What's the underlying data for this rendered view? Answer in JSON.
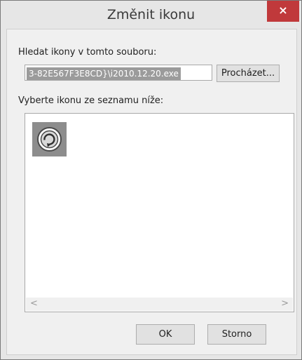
{
  "dialog": {
    "title": "Změnit ikonu",
    "close_glyph": "×"
  },
  "search_section": {
    "label": "Hledat ikony v tomto souboru:",
    "path_value": "3-82E567F3E8CD}\\i2010.12.20.exe",
    "browse_label": "Procházet..."
  },
  "icon_section": {
    "label": "Vyberte ikonu ze seznamu níže:",
    "icons": [
      {
        "name": "refresh-circle-icon",
        "selected": true
      }
    ],
    "scroll_left_glyph": "<",
    "scroll_right_glyph": ">"
  },
  "footer": {
    "ok_label": "OK",
    "cancel_label": "Storno"
  },
  "colors": {
    "close_button": "#c0393b",
    "selection": "#8d8d8d"
  }
}
